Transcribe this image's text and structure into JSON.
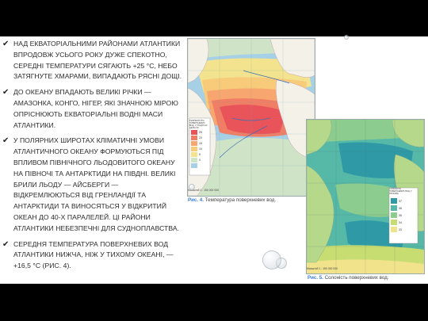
{
  "bullets": [
    "Над екваторіальними районами Атлантики впродовж усього року дуже спекотно, середні температури сягають +25 °С, небо затягнуте хмарами, випадають рясні дощі.",
    "До океану впадають великі річки — Амазонка, Конго, Нігер, які значною мірою опріснюють екваторіальні водні маси Атлантики.",
    "У полярних широтах кліматичні умови Атлантичного океану формуються під впливом Північного Льодовитого океану на півночі та Антарктиди на півдні. Великі брили льоду — айсберги — відкремлюються від Гренландії та Антарктиди та виносяться у відкритий океан до 40-х паралелей. Ці райони Атлантики небезпечні для судноплавства.",
    "Середня температура поверхневих вод Атлантики нижча, ніж у Тихому океані, — +16,5 °С (рис. 4)."
  ],
  "figure4": {
    "caption_num": "Рис. 4.",
    "caption_text": "Температура поверхневих вод.",
    "legend_title": "ТЕМПЕРАТУРА ПОВЕРХНЕВИХ ВОД, У ГРАДУСАХ ЦЕЛЬСІЯ",
    "legend_values": [
      "25",
      "20",
      "15",
      "10",
      "5",
      "0"
    ],
    "legend_colors": [
      "#e8545a",
      "#f07d64",
      "#f6a66e",
      "#f8cb7a",
      "#f3e38e",
      "#cfe3c7",
      "#a6d0e6"
    ],
    "scale": "Масштаб 1 : 150 000 000"
  },
  "figure5": {
    "caption_num": "Рис. 5.",
    "caption_text": "Солоність поверхневих вод.",
    "legend_title": "СОЛОНІСТЬ ПОВЕРХНЕВИХ ВОД, У ПРОМІЛЕ",
    "legend_values": [
      "37",
      "36",
      "35",
      "34",
      "33"
    ],
    "legend_colors": [
      "#2f9aa6",
      "#56b9a8",
      "#8ccc8e",
      "#c7dd72",
      "#f1e38c"
    ],
    "scale": "Масштаб 1 : 150 000 000"
  }
}
